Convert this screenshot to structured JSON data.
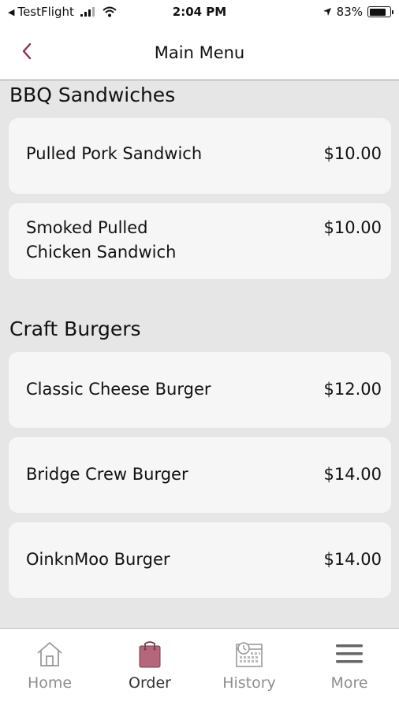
{
  "status_bar": {
    "carrier": "TestFlight",
    "time": "2:04 PM",
    "battery_percent": "83%",
    "battery_level": 0.83
  },
  "nav": {
    "title": "Main Menu"
  },
  "sections": [
    {
      "title": "BBQ Sandwiches",
      "items": [
        {
          "name": "Pulled Pork Sandwich",
          "price": "$10.00"
        },
        {
          "name": "Smoked Pulled Chicken Sandwich",
          "price": "$10.00"
        }
      ]
    },
    {
      "title": "Craft Burgers",
      "items": [
        {
          "name": "Classic Cheese Burger",
          "price": "$12.00"
        },
        {
          "name": "Bridge Crew Burger",
          "price": "$14.00"
        },
        {
          "name": "OinknMoo Burger",
          "price": "$14.00"
        }
      ]
    }
  ],
  "tabs": [
    {
      "label": "Home",
      "icon": "home-icon"
    },
    {
      "label": "Order",
      "icon": "order-bag-icon",
      "active": true
    },
    {
      "label": "History",
      "icon": "history-calendar-icon"
    },
    {
      "label": "More",
      "icon": "menu-icon"
    }
  ],
  "colors": {
    "accent": "#8b2f45",
    "order_icon": "#b4677a",
    "background": "#e6e6e6",
    "card": "#f6f6f6"
  }
}
